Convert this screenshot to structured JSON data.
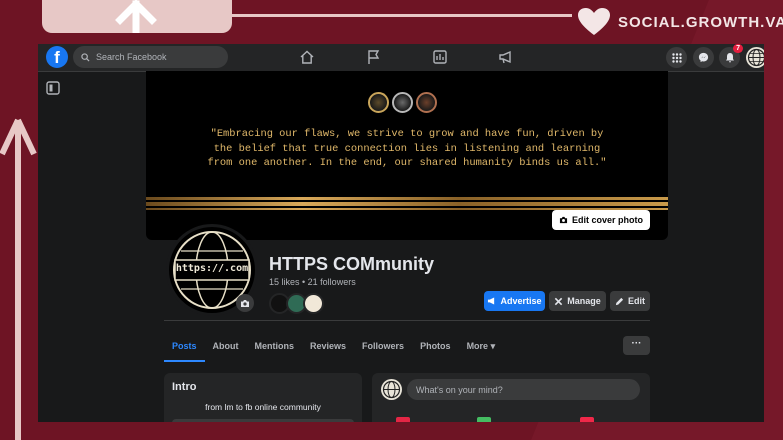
{
  "brand": {
    "text": "SOCIAL.GROWTH.VA"
  },
  "topbar": {
    "search_placeholder": "Search Facebook",
    "logo_letter": "f",
    "notification_count": "7"
  },
  "cover": {
    "quote": "\"Embracing our flaws, we strive to grow and have fun, driven by the belief that true connection lies in listening and learning from one another. In the end, our shared humanity binds us all.\"",
    "edit_label": "Edit cover photo"
  },
  "profile": {
    "logo_text": "https://.com",
    "name": "HTTPS COMmunity",
    "stats": "15 likes • 21 followers"
  },
  "actions": {
    "advertise": "Advertise",
    "manage": "Manage",
    "edit": "Edit"
  },
  "tabs": [
    {
      "label": "Posts"
    },
    {
      "label": "About"
    },
    {
      "label": "Mentions"
    },
    {
      "label": "Reviews"
    },
    {
      "label": "Followers"
    },
    {
      "label": "Photos"
    },
    {
      "label": "More ▾"
    }
  ],
  "more_menu_label": "···",
  "intro": {
    "title": "Intro",
    "bio": "from lm to fb online community"
  },
  "composer": {
    "placeholder": "What's on your mind?"
  },
  "colors": {
    "accent": "#1877f2",
    "background": "#18191a",
    "surface": "#242526",
    "maroon": "#6e1424",
    "gold": "#e0b86a"
  }
}
